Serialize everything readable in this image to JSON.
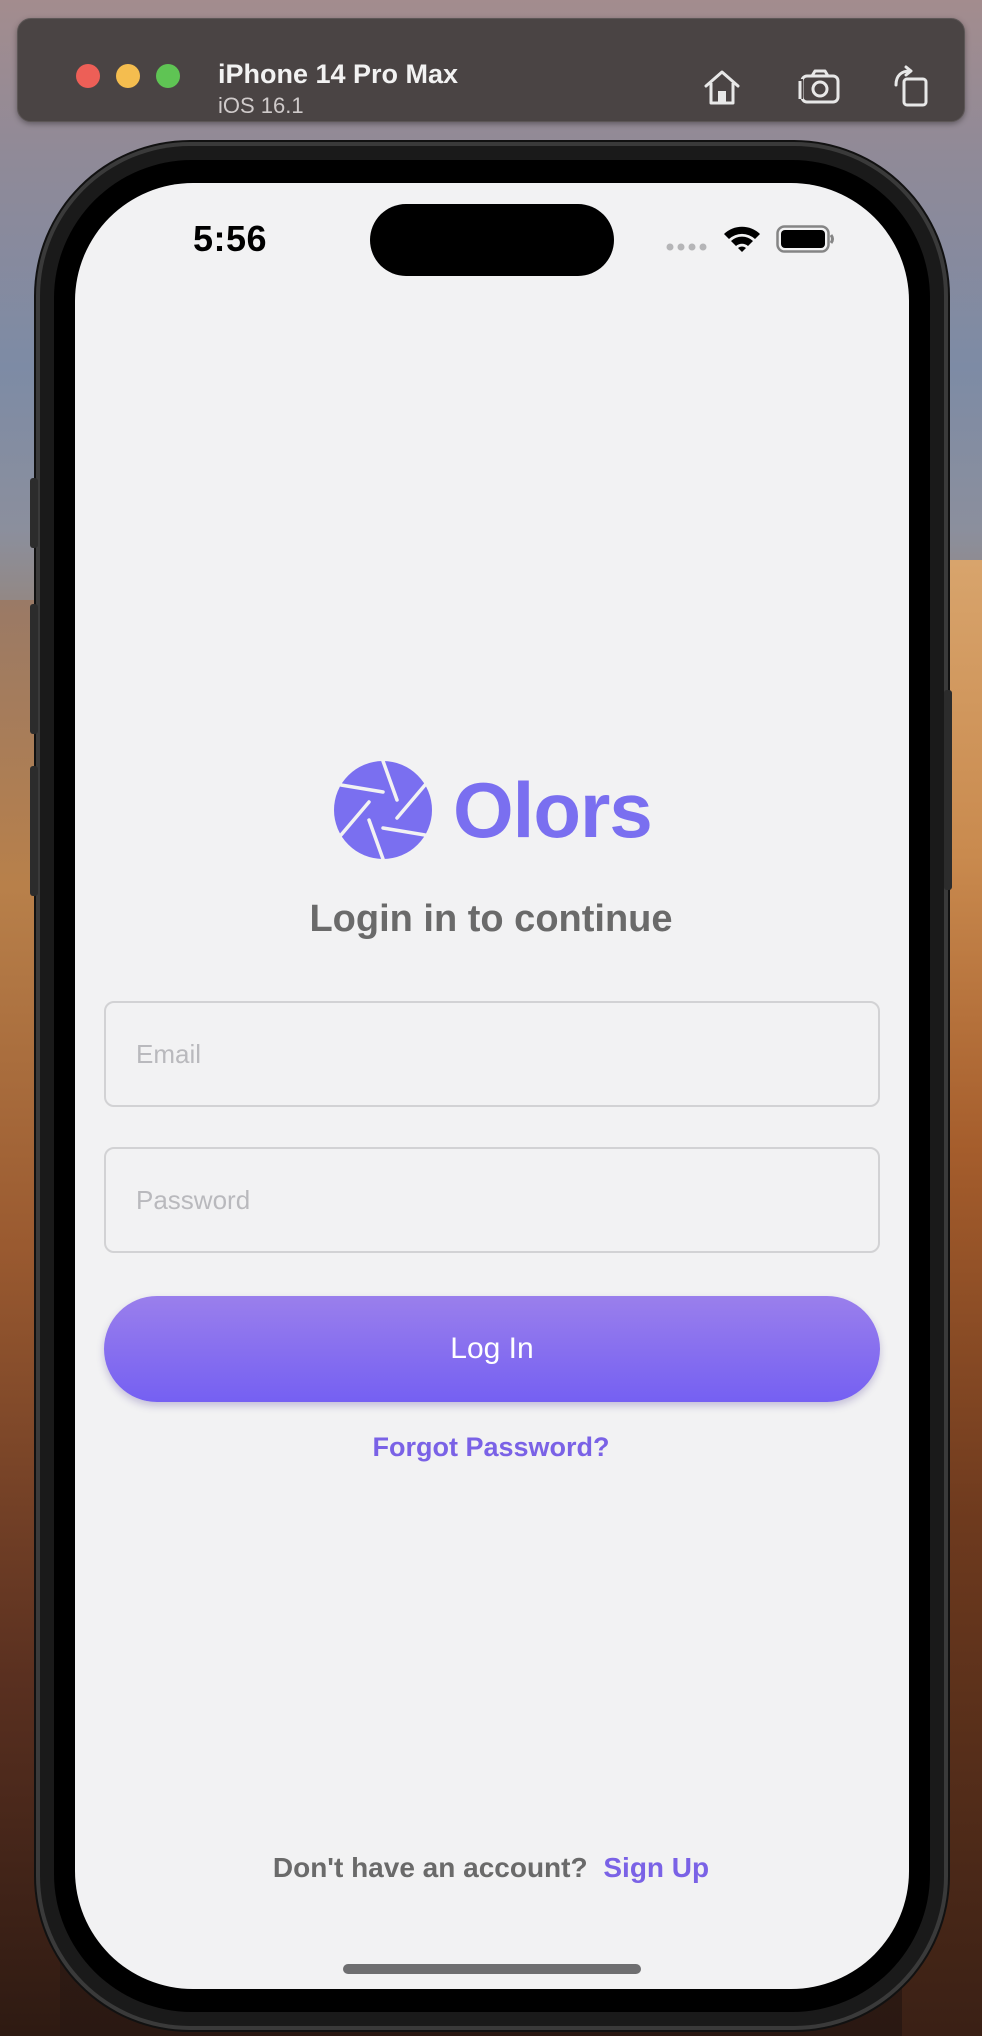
{
  "simulator": {
    "device_name": "iPhone 14 Pro Max",
    "os_version": "iOS 16.1",
    "toolbar_icons": [
      "home-icon",
      "screenshot-icon",
      "rotate-icon"
    ]
  },
  "status_bar": {
    "time": "5:56",
    "icons": [
      "signal-icon",
      "wifi-icon",
      "battery-icon"
    ]
  },
  "brand": {
    "name": "Olors",
    "logo_icon": "aperture-icon",
    "accent_color": "#7a6ff0"
  },
  "login": {
    "subtitle": "Login in to continue",
    "email_placeholder": "Email",
    "password_placeholder": "Password",
    "login_label": "Log In",
    "forgot_label": "Forgot Password?"
  },
  "footer": {
    "prompt": "Don't have an account?",
    "signup_label": "Sign Up"
  }
}
